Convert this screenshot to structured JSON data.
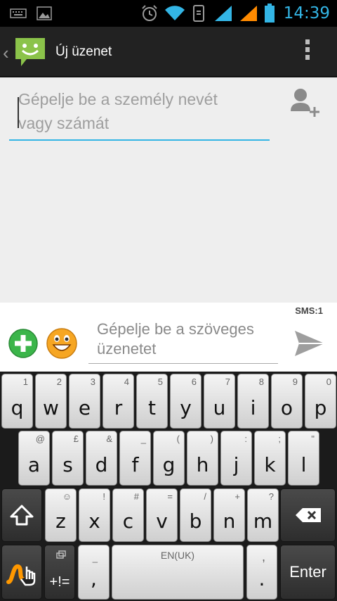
{
  "status_bar": {
    "time": "14:39",
    "icons": [
      "keyboard-icon",
      "image-icon",
      "alarm-icon",
      "wifi-icon",
      "sync-icon",
      "signal-icon",
      "signal-2-icon",
      "battery-icon"
    ],
    "accent": "#33b5e5"
  },
  "action_bar": {
    "title": "Új üzenet",
    "icons": [
      "back-chevron-icon",
      "messaging-app-icon",
      "overflow-menu-icon"
    ],
    "logo_color": "#8bc34a"
  },
  "recipient": {
    "placeholder": "Gépelje be a személy nevét vagy számát",
    "add_contact_icon": "add-contact-icon"
  },
  "compose": {
    "sms_counter": "SMS:1",
    "placeholder": "Gépelje be a szöveges üzenetet",
    "icons": [
      "add-attachment-icon",
      "emoji-icon",
      "send-icon"
    ]
  },
  "keyboard": {
    "row1": [
      {
        "main": "q",
        "alt": "1"
      },
      {
        "main": "w",
        "alt": "2"
      },
      {
        "main": "e",
        "alt": "3"
      },
      {
        "main": "r",
        "alt": "4"
      },
      {
        "main": "t",
        "alt": "5"
      },
      {
        "main": "y",
        "alt": "6"
      },
      {
        "main": "u",
        "alt": "7"
      },
      {
        "main": "i",
        "alt": "8"
      },
      {
        "main": "o",
        "alt": "9"
      },
      {
        "main": "p",
        "alt": "0"
      }
    ],
    "row2": [
      {
        "main": "a",
        "alt": "@"
      },
      {
        "main": "s",
        "alt": "£"
      },
      {
        "main": "d",
        "alt": "&"
      },
      {
        "main": "f",
        "alt": "_"
      },
      {
        "main": "g",
        "alt": "("
      },
      {
        "main": "h",
        "alt": ")"
      },
      {
        "main": "j",
        "alt": ":"
      },
      {
        "main": "k",
        "alt": ";"
      },
      {
        "main": "l",
        "alt": "\""
      }
    ],
    "row3": [
      {
        "main": "z",
        "alt": "☺"
      },
      {
        "main": "x",
        "alt": "!"
      },
      {
        "main": "c",
        "alt": "#"
      },
      {
        "main": "v",
        "alt": "="
      },
      {
        "main": "b",
        "alt": "/"
      },
      {
        "main": "n",
        "alt": "+"
      },
      {
        "main": "m",
        "alt": "?"
      }
    ],
    "bottom": {
      "symbols_label": "+!=",
      "comma": ",",
      "comma_alt": "_",
      "space_label": "EN(UK)",
      "period": ".",
      "period_alt": ",",
      "enter_label": "Enter"
    },
    "icons": [
      "shift-icon",
      "backspace-icon",
      "swype-icon",
      "symbols-icon"
    ]
  }
}
